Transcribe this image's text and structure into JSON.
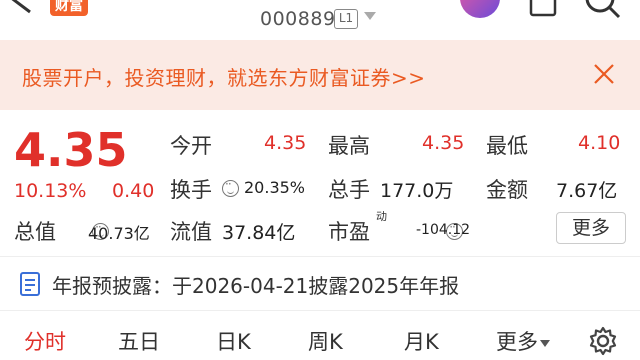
{
  "header": {
    "logo_text": "财富",
    "stock_code": "000889",
    "level_badge": "L1",
    "icons": [
      "back-icon",
      "avatar",
      "share-icon",
      "search-icon"
    ]
  },
  "banner": {
    "text": "股票开户，投资理财，就选东方财富证券>>",
    "close_icon": "close-icon",
    "color": "#ea5a22"
  },
  "quote": {
    "price": "4.35",
    "change_pct": "10.13%",
    "change_amt": "0.40",
    "up_color": "#e0302a",
    "fields": {
      "open_label": "今开",
      "open_value": "4.35",
      "high_label": "最高",
      "high_value": "4.35",
      "low_label": "最低",
      "low_value": "4.10",
      "turnover_label": "换手",
      "turnover_value": "20.35%",
      "volume_label": "总手",
      "volume_value": "177.0万",
      "amount_label": "金额",
      "amount_value": "7.67亿",
      "mktcap_label": "总值",
      "mktcap_value": "40.73亿",
      "float_label": "流值",
      "float_value": "37.84亿",
      "pe_label": "市盈",
      "pe_super": "动",
      "pe_value": "-104.12"
    },
    "more_label": "更多"
  },
  "report": {
    "text": "年报预披露：于2026-04-21披露2025年年报"
  },
  "tabs": [
    {
      "label": "分时",
      "active": true
    },
    {
      "label": "五日"
    },
    {
      "label": "日K"
    },
    {
      "label": "周K"
    },
    {
      "label": "月K"
    },
    {
      "label": "更多"
    }
  ]
}
